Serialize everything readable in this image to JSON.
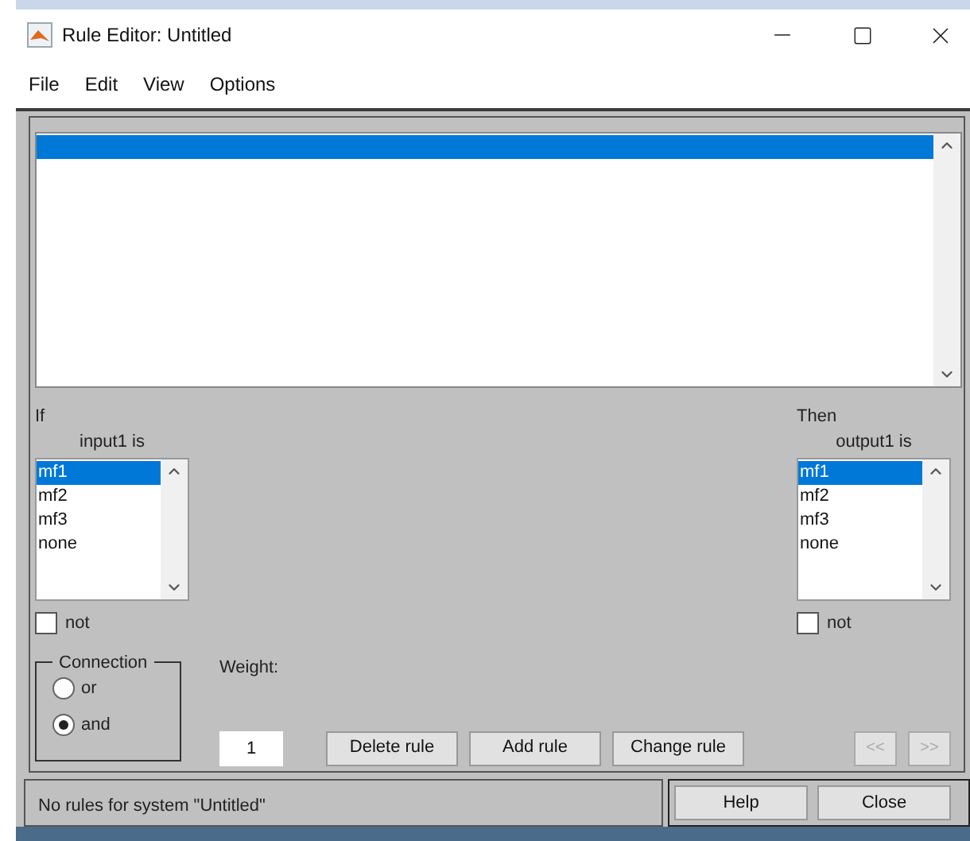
{
  "window": {
    "title": "Rule Editor: Untitled"
  },
  "menu": [
    "File",
    "Edit",
    "View",
    "Options"
  ],
  "rule_list": {
    "highlighted": true
  },
  "antecedent": {
    "heading": "If",
    "variable_label": "input1 is",
    "items": [
      {
        "label": "mf1",
        "selected": true
      },
      {
        "label": "mf2",
        "selected": false
      },
      {
        "label": "mf3",
        "selected": false
      },
      {
        "label": "none",
        "selected": false
      }
    ],
    "not": {
      "label": "not",
      "checked": false
    }
  },
  "consequent": {
    "heading": "Then",
    "variable_label": "output1 is",
    "items": [
      {
        "label": "mf1",
        "selected": true
      },
      {
        "label": "mf2",
        "selected": false
      },
      {
        "label": "mf3",
        "selected": false
      },
      {
        "label": "none",
        "selected": false
      }
    ],
    "not": {
      "label": "not",
      "checked": false
    }
  },
  "connection": {
    "title": "Connection",
    "options": [
      {
        "label": "or",
        "selected": false
      },
      {
        "label": "and",
        "selected": true
      }
    ]
  },
  "weight": {
    "label": "Weight:",
    "value": "1"
  },
  "buttons": [
    "Delete rule",
    "Add rule",
    "Change rule"
  ],
  "nav_buttons": [
    {
      "label": "<<",
      "disabled": true
    },
    {
      "label": ">>",
      "disabled": true
    }
  ],
  "status": "No rules for system \"Untitled\"",
  "footer_buttons": [
    "Help",
    "Close"
  ]
}
